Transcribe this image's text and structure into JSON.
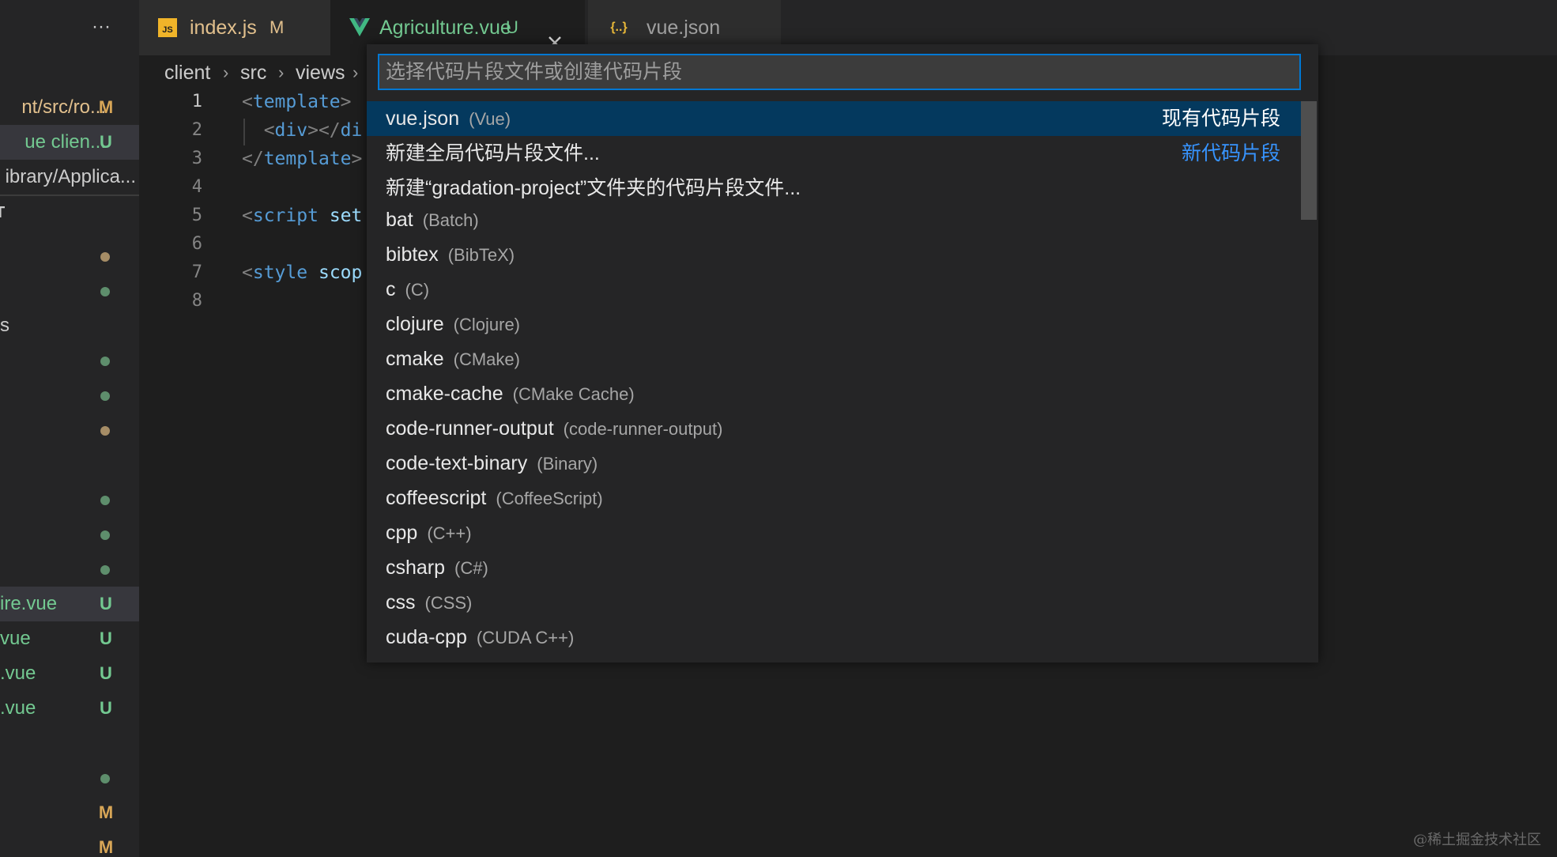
{
  "explorer": {
    "more_label": "···",
    "open_editors": [
      {
        "name": "nt/src/ro...",
        "badge": "M",
        "badge_color": "#d8a657",
        "text_color": "#e2c08d"
      },
      {
        "name": "ue  clien...",
        "badge": "U",
        "badge_color": "#73c991",
        "text_color": "#73c991",
        "active": true
      },
      {
        "name": "ibrary/Applica...",
        "badge": "",
        "text_color": "#cccccc"
      }
    ],
    "section_label": "T",
    "tree": [
      {
        "type": "dot",
        "color": "#a68d66"
      },
      {
        "type": "dot",
        "color": "#5e8e6c"
      },
      {
        "type": "folder",
        "name": "s",
        "text_color": "#cccccc"
      },
      {
        "type": "dot",
        "color": "#5e8e6c"
      },
      {
        "type": "dot",
        "color": "#5e8e6c"
      },
      {
        "type": "dot",
        "color": "#a68d66"
      },
      {
        "type": "blank"
      },
      {
        "type": "dot",
        "color": "#5e8e6c"
      },
      {
        "type": "dot",
        "color": "#5e8e6c"
      },
      {
        "type": "dot",
        "color": "#5e8e6c"
      },
      {
        "type": "file",
        "name": "ire.vue",
        "badge": "U",
        "text_color": "#73c991",
        "active": true
      },
      {
        "type": "file",
        "name": "vue",
        "badge": "U",
        "text_color": "#73c991"
      },
      {
        "type": "file",
        "name": ".vue",
        "badge": "U",
        "text_color": "#73c991"
      },
      {
        "type": "file",
        "name": ".vue",
        "badge": "U",
        "text_color": "#73c991"
      },
      {
        "type": "blank"
      },
      {
        "type": "dot",
        "color": "#5e8e6c"
      },
      {
        "type": "file",
        "name": "",
        "badge": "M",
        "badge_color": "#d8a657"
      },
      {
        "type": "file",
        "name": "",
        "badge": "M",
        "badge_color": "#d8a657"
      }
    ]
  },
  "tabs": [
    {
      "label": "index.js",
      "status": "M",
      "icon": "js-file-icon",
      "icon_text": "JS",
      "label_color": "#e2c08d",
      "status_color": "#e2c08d"
    },
    {
      "label": "Agriculture.vue",
      "status": "U",
      "icon": "vue-file-icon",
      "label_color": "#73c991",
      "status_color": "#73c991",
      "active": true
    },
    {
      "label": "vue.json",
      "status": "",
      "icon": "json-file-icon",
      "icon_text": "{..}",
      "label_color": "#a0a0a0"
    }
  ],
  "breadcrumb": [
    "client",
    "src",
    "views"
  ],
  "editor": {
    "lines": [
      {
        "no": "1",
        "current": true,
        "parts": [
          [
            "t",
            "<"
          ],
          [
            "tag",
            "template"
          ],
          [
            "t",
            ">"
          ]
        ]
      },
      {
        "no": "2",
        "parts": [
          [
            "t",
            "  <"
          ],
          [
            "tag",
            "div"
          ],
          [
            "t",
            "></"
          ],
          [
            "tag",
            "di"
          ]
        ]
      },
      {
        "no": "3",
        "parts": [
          [
            "t",
            "</"
          ],
          [
            "tag",
            "template"
          ],
          [
            "t",
            ">"
          ]
        ]
      },
      {
        "no": "4",
        "parts": []
      },
      {
        "no": "5",
        "parts": [
          [
            "t",
            "<"
          ],
          [
            "tag",
            "script"
          ],
          [
            "t",
            " "
          ],
          [
            "attr",
            "set"
          ]
        ]
      },
      {
        "no": "6",
        "parts": []
      },
      {
        "no": "7",
        "parts": [
          [
            "t",
            "<"
          ],
          [
            "tag",
            "style"
          ],
          [
            "t",
            " "
          ],
          [
            "attr",
            "scop"
          ]
        ]
      },
      {
        "no": "8",
        "parts": []
      }
    ]
  },
  "quickpick": {
    "placeholder": "选择代码片段文件或创建代码片段",
    "value": "",
    "items": [
      {
        "label": "vue.json",
        "description": "(Vue)",
        "detail": "现有代码片段",
        "selected": true
      },
      {
        "label": "新建全局代码片段文件...",
        "description": "",
        "detail": "新代码片段",
        "detail_link": true
      },
      {
        "label": "新建“gradation-project”文件夹的代码片段文件...",
        "description": "",
        "detail": ""
      },
      {
        "label": "bat",
        "description": "(Batch)"
      },
      {
        "label": "bibtex",
        "description": "(BibTeX)"
      },
      {
        "label": "c",
        "description": "(C)"
      },
      {
        "label": "clojure",
        "description": "(Clojure)"
      },
      {
        "label": "cmake",
        "description": "(CMake)"
      },
      {
        "label": "cmake-cache",
        "description": "(CMake Cache)"
      },
      {
        "label": "code-runner-output",
        "description": "(code-runner-output)"
      },
      {
        "label": "code-text-binary",
        "description": "(Binary)"
      },
      {
        "label": "coffeescript",
        "description": "(CoffeeScript)"
      },
      {
        "label": "cpp",
        "description": "(C++)"
      },
      {
        "label": "csharp",
        "description": "(C#)"
      },
      {
        "label": "css",
        "description": "(CSS)"
      },
      {
        "label": "cuda-cpp",
        "description": "(CUDA C++)"
      }
    ]
  },
  "watermark": "@稀土掘金技术社区",
  "colors": {
    "accent": "#0078d4",
    "selection": "#04395e",
    "link": "#3794ff",
    "modified": "#e2c08d",
    "untracked": "#73c991"
  }
}
